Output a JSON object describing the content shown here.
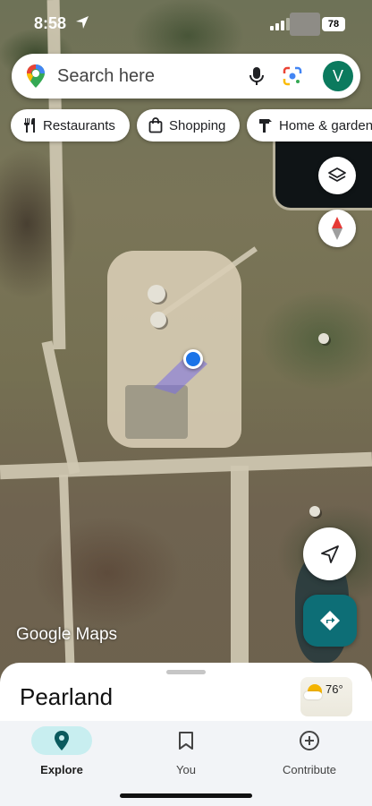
{
  "status_bar": {
    "time": "8:58",
    "battery": "78"
  },
  "search": {
    "placeholder": "Search here",
    "avatar_initial": "V"
  },
  "chips": [
    {
      "label": "Restaurants",
      "icon": "fork-knife-icon"
    },
    {
      "label": "Shopping",
      "icon": "shopping-bag-icon"
    },
    {
      "label": "Home & garden",
      "icon": "hammer-icon"
    }
  ],
  "map": {
    "attribution": "Google Maps",
    "view": "satellite"
  },
  "sheet": {
    "place_name": "Pearland",
    "temperature": "76°"
  },
  "nav": [
    {
      "label": "Explore",
      "icon": "pin-icon",
      "selected": true
    },
    {
      "label": "You",
      "icon": "bookmark-icon",
      "selected": false
    },
    {
      "label": "Contribute",
      "icon": "plus-circle-icon",
      "selected": false
    }
  ],
  "colors": {
    "accent": "#0d6e76",
    "explore_pill": "#c8eef0",
    "location_dot": "#1a73e8",
    "avatar": "#0b7a5e"
  }
}
